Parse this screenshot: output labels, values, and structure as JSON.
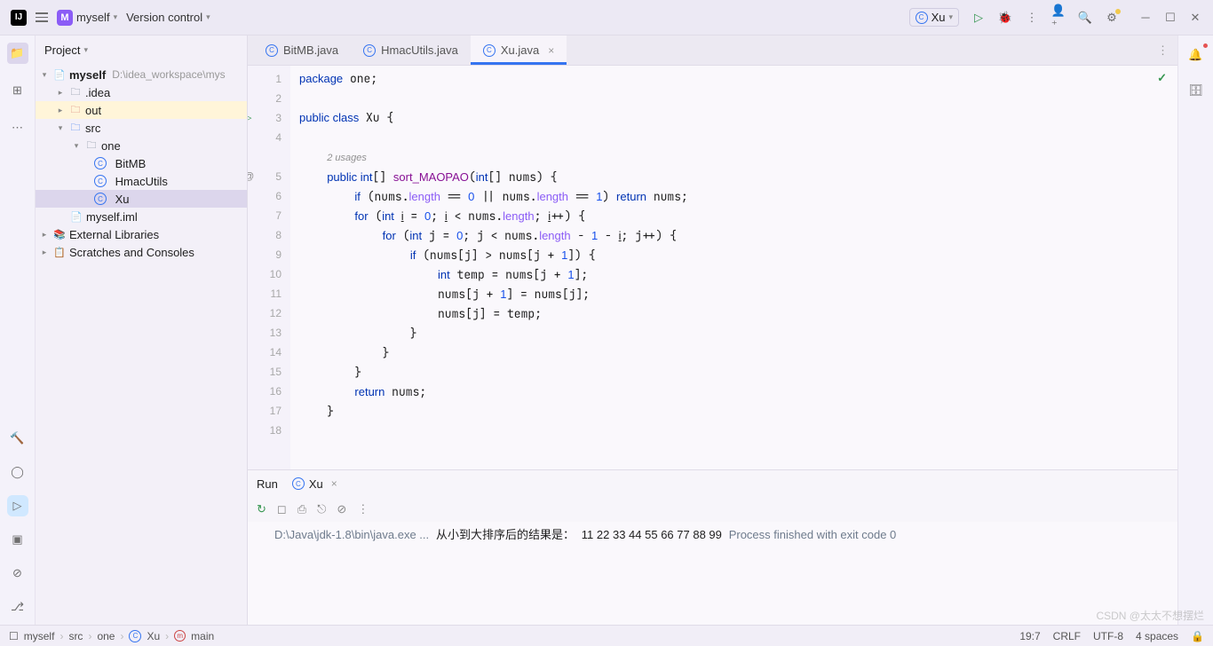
{
  "titlebar": {
    "project": "myself",
    "project_initial": "M",
    "vcs": "Version control",
    "run_config": "Xu"
  },
  "project_panel": {
    "title": "Project",
    "root": {
      "name": "myself",
      "path": "D:\\idea_workspace\\mys"
    },
    "nodes": {
      "idea": ".idea",
      "out": "out",
      "src": "src",
      "one": "one",
      "bitmb": "BitMB",
      "hmac": "HmacUtils",
      "xu": "Xu",
      "iml": "myself.iml",
      "ext": "External Libraries",
      "scratch": "Scratches and Consoles"
    }
  },
  "tabs": [
    {
      "label": "BitMB.java"
    },
    {
      "label": "HmacUtils.java"
    },
    {
      "label": "Xu.java"
    }
  ],
  "code": {
    "usages": "2 usages",
    "lines": {
      "l1": "package one;",
      "l3a": "public class",
      "l3b": " Xu {",
      "l5a": "public int",
      "l5b": "[] ",
      "l5c": "sort_MAOPAO",
      "l5d": "(",
      "l5e": "int",
      "l5f": "[] nums) {",
      "l6a": "if ",
      "l6b": "(nums.",
      "l6c": "length",
      "l6d": " == ",
      "l6e": "0",
      "l6f": " || nums.",
      "l6g": "length",
      "l6h": " == ",
      "l6i": "1",
      "l6j": ") ",
      "l6k": "return ",
      "l6l": "nums;",
      "l7a": "for ",
      "l7b": "(",
      "l7c": "int ",
      "l7d": "i = ",
      "l7e": "0",
      "l7f": "; i < nums.",
      "l7g": "length",
      "l7h": "; i++) {",
      "l8a": "for ",
      "l8b": "(",
      "l8c": "int ",
      "l8d": "j = ",
      "l8e": "0",
      "l8f": "; j < nums.",
      "l8g": "length",
      "l8h": " - ",
      "l8i": "1",
      "l8j": " - i; j++) {",
      "l9a": "if ",
      "l9b": "(nums[j] > nums[j + ",
      "l9c": "1",
      "l9d": "]) {",
      "l10a": "int ",
      "l10b": "temp = nums[j + ",
      "l10c": "1",
      "l10d": "];",
      "l11a": "nums[j + ",
      "l11b": "1",
      "l11c": "] = nums[j];",
      "l12": "nums[j] = temp;",
      "l16a": "return ",
      "l16b": "nums;"
    }
  },
  "run_panel": {
    "title": "Run",
    "config": "Xu",
    "console": {
      "l1": "D:\\Java\\jdk-1.8\\bin\\java.exe ...",
      "l2": "从小到大排序后的结果是：",
      "l3": "11 22 33 44 55 66 77 88 99",
      "l4": "Process finished with exit code 0"
    }
  },
  "breadcrumb": {
    "p1": "myself",
    "p2": "src",
    "p3": "one",
    "p4": "Xu",
    "p5": "main"
  },
  "status": {
    "pos": "19:7",
    "line_sep": "CRLF",
    "encoding": "UTF-8",
    "indent": "4 spaces"
  },
  "watermark": "CSDN @太太不想摆烂"
}
